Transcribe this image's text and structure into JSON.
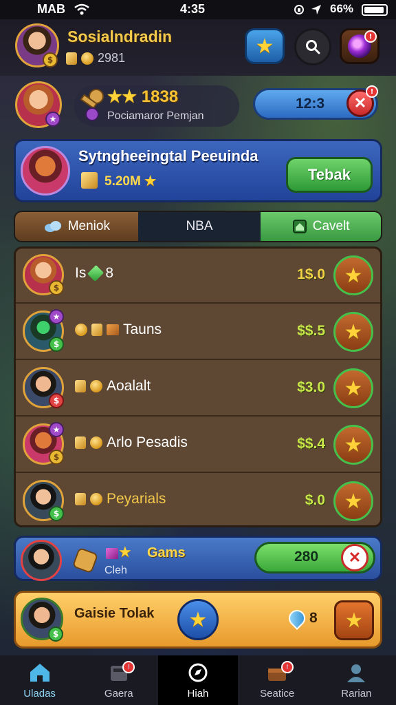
{
  "status_bar": {
    "carrier": "MAB",
    "time": "4:35",
    "battery": "66%"
  },
  "header": {
    "username": "Sosialndradin",
    "coins": "2981"
  },
  "level": {
    "score": "1838",
    "subtitle": "Pociamaror Pemjan",
    "time": "12:3"
  },
  "banner": {
    "title": "Sytngheeingtal Peeuinda",
    "amount": "5.20M",
    "button": "Tebak"
  },
  "tabs": [
    {
      "label": "Meniok"
    },
    {
      "label": "NBA"
    },
    {
      "label": "Cavelt"
    }
  ],
  "list": [
    {
      "name": "Is",
      "extra": "8",
      "price": "1$.0"
    },
    {
      "name": "Tauns",
      "extra": "",
      "price": "$$.5"
    },
    {
      "name": "Aoalalt",
      "extra": "",
      "price": "$3.0"
    },
    {
      "name": "Arlo Pesadis",
      "extra": "",
      "price": "$$.4"
    },
    {
      "name": "Peyarials",
      "extra": "",
      "price": "$.0"
    }
  ],
  "gems_card": {
    "title": "Gams",
    "subtitle": "Cleh",
    "value": "280"
  },
  "total_card": {
    "title": "Gaisie Tolak",
    "count": "8"
  },
  "bottom_nav": [
    {
      "label": "Uladas"
    },
    {
      "label": "Gaera"
    },
    {
      "label": "Hiah"
    },
    {
      "label": "Seatice"
    },
    {
      "label": "Rarian"
    }
  ],
  "colors": {
    "accent_gold": "#f2c94a",
    "green": "#45c04a",
    "blue": "#3c67bd",
    "red": "#e24242"
  }
}
